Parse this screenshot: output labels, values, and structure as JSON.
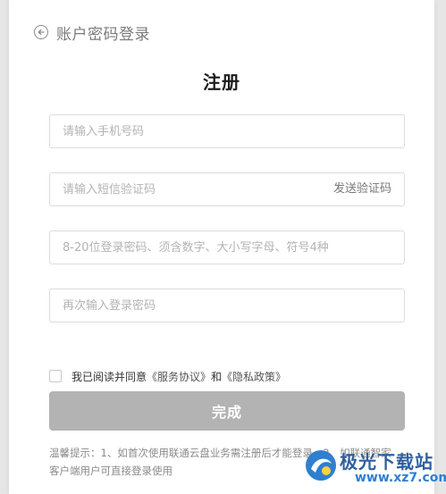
{
  "back": {
    "label": "账户密码登录"
  },
  "title": "注册",
  "form": {
    "phone": {
      "placeholder": "请输入手机号码",
      "value": ""
    },
    "sms_code": {
      "placeholder": "请输入短信验证码",
      "value": "",
      "send_label": "发送验证码"
    },
    "password": {
      "placeholder": "8-20位登录密码、须含数字、大小写字母、符号4种",
      "value": ""
    },
    "password_confirm": {
      "placeholder": "再次输入登录密码",
      "value": ""
    }
  },
  "agreement": {
    "prefix": "我已阅读并同意",
    "service_link": "《服务协议》",
    "conjunction": "和",
    "privacy_link": "《隐私政策》",
    "checked": false
  },
  "submit_label": "完成",
  "tip": {
    "line1": "温馨提示：1、如首次使用联通云盘业务需注册后才能登录，2、如联通智家",
    "line2": "客户端用户可直接登录使用"
  },
  "watermark": {
    "text": "极光下载站",
    "url": "www.xz7.com"
  },
  "colors": {
    "button_disabled": "#b3b3b3",
    "border": "#dcdcdc",
    "watermark": "#2f5f9e"
  }
}
